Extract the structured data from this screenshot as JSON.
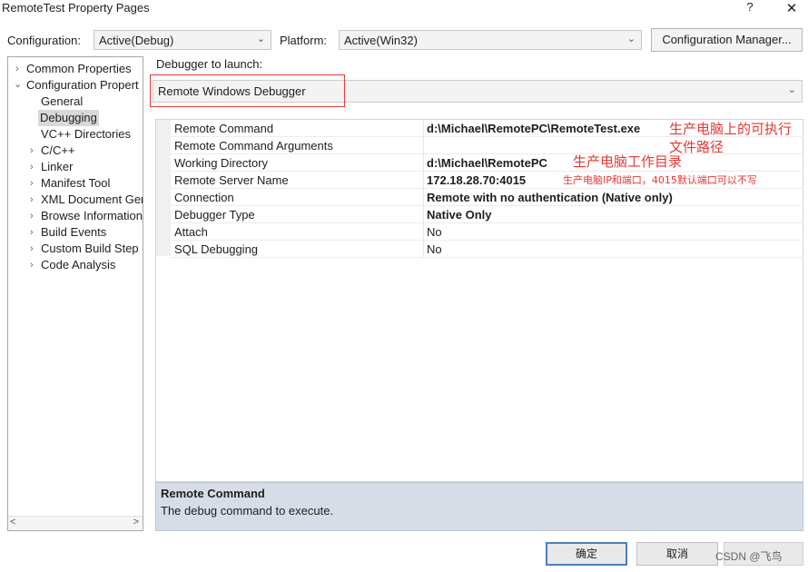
{
  "window": {
    "title": "RemoteTest Property Pages",
    "help_glyph": "?",
    "close_glyph": "✕"
  },
  "config_bar": {
    "configuration_label": "Configuration:",
    "configuration_value": "Active(Debug)",
    "platform_label": "Platform:",
    "platform_value": "Active(Win32)",
    "manager_button": "Configuration Manager..."
  },
  "tree": {
    "items": [
      {
        "label": "Common Properties",
        "arrow": "›"
      },
      {
        "label": "Configuration Propert",
        "arrow": "⌄"
      },
      {
        "label": "General"
      },
      {
        "label": "Debugging"
      },
      {
        "label": "VC++ Directories"
      },
      {
        "label": "C/C++",
        "arrow": "›"
      },
      {
        "label": "Linker",
        "arrow": "›"
      },
      {
        "label": "Manifest Tool",
        "arrow": "›"
      },
      {
        "label": "XML Document Ger",
        "arrow": "›"
      },
      {
        "label": "Browse Information",
        "arrow": "›"
      },
      {
        "label": "Build Events",
        "arrow": "›"
      },
      {
        "label": "Custom Build Step",
        "arrow": "›"
      },
      {
        "label": "Code Analysis",
        "arrow": "›"
      }
    ],
    "selected": "Debugging",
    "scroll_left": "<",
    "scroll_right": ">"
  },
  "debugger": {
    "label": "Debugger to launch:",
    "value": "Remote Windows Debugger"
  },
  "properties": [
    {
      "name": "Remote Command",
      "value": "d:\\Michael\\RemotePC\\RemoteTest.exe",
      "bold": true
    },
    {
      "name": "Remote Command Arguments",
      "value": "",
      "bold": false
    },
    {
      "name": "Working Directory",
      "value": "d:\\Michael\\RemotePC",
      "bold": true
    },
    {
      "name": "Remote Server Name",
      "value": "172.18.28.70:4015",
      "bold": true
    },
    {
      "name": "Connection",
      "value": "Remote with no authentication (Native only)",
      "bold": true
    },
    {
      "name": "Debugger Type",
      "value": "Native Only",
      "bold": true
    },
    {
      "name": "Attach",
      "value": "No",
      "bold": false
    },
    {
      "name": "SQL Debugging",
      "value": "No",
      "bold": false
    }
  ],
  "annotations": {
    "remote_command_line1": "生产电脑上的可执行",
    "remote_command_line2": "文件路径",
    "working_dir": "生产电脑工作目录",
    "server": "生产电脑IP和端口，4015默认端口可以不写"
  },
  "description": {
    "title": "Remote Command",
    "text": "The debug command to execute."
  },
  "footer": {
    "ok": "确定",
    "cancel": "取消",
    "watermark": "CSDN @飞鸟"
  },
  "colors": {
    "annotation_red": "#e53935",
    "description_bg": "#d7dde6",
    "ok_border": "#4a7fc0"
  }
}
